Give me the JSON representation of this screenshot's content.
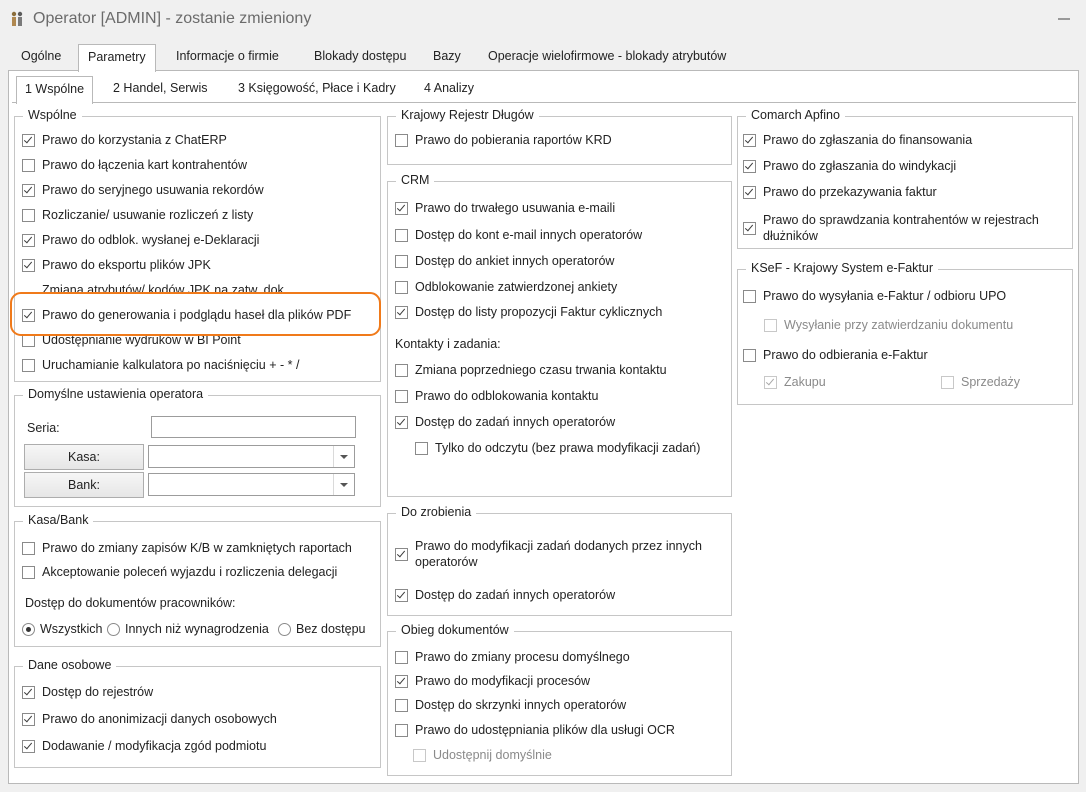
{
  "window": {
    "title": "Operator [ADMIN] - zostanie zmieniony"
  },
  "tabs": [
    "Ogólne",
    "Parametry",
    "Informacje o firmie",
    "Blokady dostępu",
    "Bazy",
    "Operacje wielofirmowe - blokady atrybutów"
  ],
  "subtabs": [
    "1 Wspólne",
    "2 Handel, Serwis",
    "3 Księgowość, Płace i Kadry",
    "4 Analizy"
  ],
  "wspolne": {
    "title": "Wspólne",
    "items": [
      "Prawo do korzystania z ChatERP",
      "Prawo do łączenia kart kontrahentów",
      "Prawo do seryjnego usuwania rekordów",
      "Rozliczanie/ usuwanie rozliczeń z listy",
      "Prawo do odblok. wysłanej e-Deklaracji",
      "Prawo do eksportu plików JPK",
      "Zmiana atrybutów/ kodów JPK na zatw. dok.",
      "Prawo do generowania i podglądu haseł dla plików PDF",
      "Udostępnianie wydruków w BI Point",
      "Uruchamianie kalkulatora po naciśnięciu + - * /"
    ]
  },
  "domyslne": {
    "title": "Domyślne ustawienia operatora",
    "seria_label": "Seria:",
    "kasa_label": "Kasa:",
    "bank_label": "Bank:"
  },
  "kasabank": {
    "title": "Kasa/Bank",
    "items": [
      "Prawo do zmiany zapisów K/B w zamkniętych raportach",
      "Akceptowanie poleceń wyjazdu i rozliczenia delegacji"
    ],
    "dostep_label": "Dostęp do dokumentów pracowników:",
    "radios": [
      "Wszystkich",
      "Innych niż wynagrodzenia",
      "Bez dostępu"
    ]
  },
  "dane": {
    "title": "Dane osobowe",
    "items": [
      "Dostęp do rejestrów",
      "Prawo do anonimizacji danych osobowych",
      "Dodawanie / modyfikacja zgód podmiotu"
    ]
  },
  "krd": {
    "title": "Krajowy Rejestr Długów",
    "items": [
      "Prawo do pobierania raportów KRD"
    ]
  },
  "crm": {
    "title": "CRM",
    "items": [
      "Prawo do trwałego usuwania e-maili",
      "Dostęp do kont e-mail innych operatorów",
      "Dostęp do ankiet innych operatorów",
      "Odblokowanie zatwierdzonej ankiety",
      "Dostęp do listy propozycji Faktur cyklicznych"
    ],
    "kontakty_label": "Kontakty i zadania:",
    "kontakty": [
      "Zmiana poprzedniego czasu trwania kontaktu",
      "Prawo do odblokowania kontaktu",
      "Dostęp do zadań innych operatorów",
      "Tylko do odczytu (bez prawa modyfikacji zadań)"
    ]
  },
  "dozrobienia": {
    "title": "Do zrobienia",
    "item1_line1": "Prawo do modyfikacji zadań dodanych przez innych",
    "item1_line2": "operatorów",
    "item2": "Dostęp do zadań innych operatorów"
  },
  "obieg": {
    "title": "Obieg dokumentów",
    "items": [
      "Prawo do zmiany procesu domyślnego",
      "Prawo do modyfikacji procesów",
      "Dostęp do skrzynki innych operatorów",
      "Prawo do udostępniania plików dla usługi OCR",
      "Udostępnij domyślnie"
    ]
  },
  "apfino": {
    "title": "Comarch Apfino",
    "items": [
      "Prawo do zgłaszania do finansowania",
      "Prawo do zgłaszania do windykacji",
      "Prawo do przekazywania faktur"
    ],
    "item4_line1": "Prawo do sprawdzania kontrahentów w rejestrach",
    "item4_line2": "dłużników"
  },
  "ksef": {
    "title": "KSeF - Krajowy System e-Faktur",
    "items": [
      "Prawo do wysyłania e-Faktur / odbioru UPO",
      "Wysyłanie przy zatwierdzaniu dokumentu",
      "Prawo do odbierania e-Faktur",
      "Zakupu",
      "Sprzedaży"
    ]
  },
  "colors": {
    "highlight": "#f07a1a"
  }
}
